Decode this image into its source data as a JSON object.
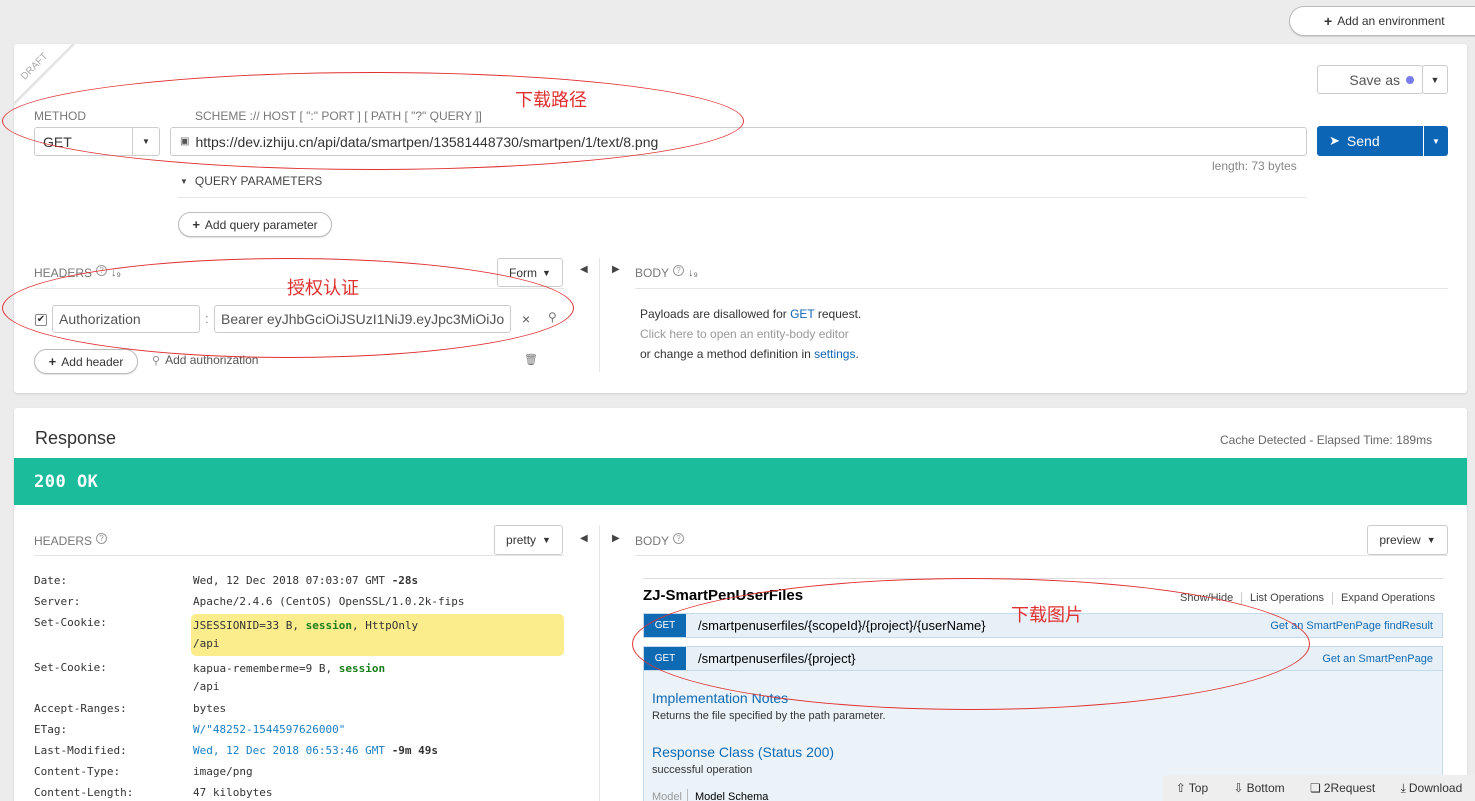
{
  "topbar": {
    "add_env_label": "Add an environment"
  },
  "request": {
    "draft_label": "DRAFT",
    "save_as_label": "Save as",
    "method_label": "METHOD",
    "method_value": "GET",
    "url_label": "SCHEME :// HOST [ \":\" PORT ] [ PATH [ \"?\" QUERY ]]",
    "url_value": "https://dev.izhiju.cn/api/data/smartpen/13581448730/smartpen/1/text/8.png",
    "length_text": "length: 73 bytes",
    "send_label": "Send",
    "query_params_label": "QUERY PARAMETERS",
    "add_query_label": "Add query parameter",
    "headers_label": "HEADERS",
    "form_label": "Form",
    "header_name": "Authorization",
    "header_value": "Bearer eyJhbGciOiJSUzI1NiJ9.eyJpc3MiOiJo",
    "add_header_label": "Add header",
    "add_auth_label": "Add authorization",
    "body_label": "BODY",
    "body_line1_pre": "Payloads are disallowed for ",
    "body_line1_link": "GET",
    "body_line1_post": " request.",
    "body_line2": "Click here to open an entity-body editor",
    "body_line3_pre": "or change a method definition in ",
    "body_line3_link": "settings",
    "body_line3_post": "."
  },
  "annotations": {
    "download_path": "下载路径",
    "auth": "授权认证",
    "download_image": "下载图片"
  },
  "response": {
    "title": "Response",
    "cache_text": "Cache Detected - Elapsed Time: 189ms",
    "status_text": "200 OK",
    "status_color": "#1abc9c",
    "headers_label": "HEADERS",
    "pretty_label": "pretty",
    "body_label": "BODY",
    "preview_label": "preview",
    "headers": [
      {
        "key": "Date:",
        "value": "Wed, 12 Dec 2018 07:03:07 GMT",
        "extra": "-28s"
      },
      {
        "key": "Server:",
        "value": "Apache/2.4.6 (CentOS) OpenSSL/1.0.2k-fips"
      },
      {
        "key": "Set-Cookie:",
        "value_pre": "JSESSIONID=33 B, ",
        "value_kw1": "session",
        "value_mid": ", ",
        "value_kw2": "HttpOnly",
        "value_line2": "/api"
      },
      {
        "key": "Set-Cookie:",
        "value_pre": "kapua-rememberme=9 B, ",
        "value_kw1": "session",
        "value_line2": "/api"
      },
      {
        "key": "Accept-Ranges:",
        "value": "bytes"
      },
      {
        "key": "ETag:",
        "value": "W/\"48252-1544597626000\""
      },
      {
        "key": "Last-Modified:",
        "value": "Wed, 12 Dec 2018 06:53:46 GMT",
        "extra": "-9m 49s"
      },
      {
        "key": "Content-Type:",
        "value": "image/png"
      },
      {
        "key": "Content-Length:",
        "value": "47 kilobytes"
      }
    ]
  },
  "swagger": {
    "title": "ZJ-SmartPenUserFiles",
    "show_hide": "Show/Hide",
    "list_ops": "List Operations",
    "expand_ops": "Expand Operations",
    "ops": [
      {
        "method": "GET",
        "path": "/smartpenuserfiles/{scopeId}/{project}/{userName}",
        "summary": "Get an SmartPenPage findResult"
      },
      {
        "method": "GET",
        "path": "/smartpenuserfiles/{project}",
        "summary": "Get an SmartPenPage"
      }
    ],
    "impl_notes_title": "Implementation Notes",
    "impl_notes_text": "Returns the file specified by the path parameter.",
    "resp_class_title": "Response Class (Status 200)",
    "resp_class_text": "successful operation",
    "tab_model": "Model",
    "tab_schema": "Model Schema"
  },
  "footer": {
    "top": "Top",
    "bottom": "Bottom",
    "to_request": "2Request",
    "download": "Download"
  }
}
